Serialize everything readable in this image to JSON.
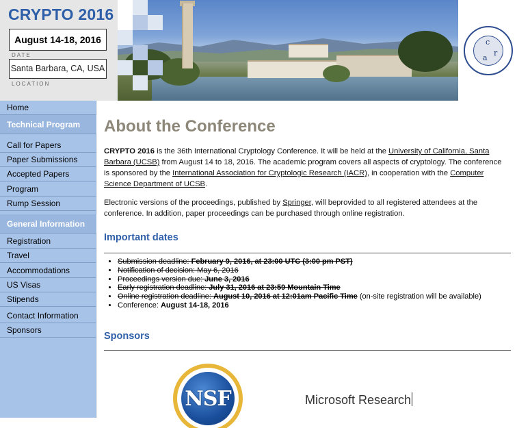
{
  "header": {
    "brand": "CRYPTO 2016",
    "date": "August 14-18, 2016",
    "date_caption": "DATE",
    "location": "Santa Barbara, CA, USA",
    "location_caption": "LOCATION",
    "seal_letters": [
      "c",
      "r",
      "a"
    ]
  },
  "sidebar": {
    "home": "Home",
    "technical_heading": "Technical Program",
    "technical_items": [
      "Call for Papers",
      "Paper Submissions",
      "Accepted Papers",
      "Program",
      "Rump Session"
    ],
    "general_heading": "General Information",
    "general_items": [
      "Registration",
      "Travel",
      "Accommodations",
      "US Visas",
      "Stipends"
    ],
    "extra_items": [
      "Contact Information",
      "Sponsors"
    ]
  },
  "main": {
    "title": "About the Conference",
    "intro": {
      "strong": "CRYPTO 2016",
      "t1": " is the 36th International Cryptology Conference. It will be held at the ",
      "link_ucsb": "University of California, Santa Barbara (UCSB)",
      "t2": " from August 14 to 18, 2016. The academic program covers all aspects of cryptology. The conference is sponsored by the ",
      "link_iacr": "International Association for Cryptologic Research (IACR)",
      "t3": ", in cooperation with the ",
      "link_cs": "Computer Science Department of UCSB",
      "t4": "."
    },
    "proceedings": {
      "t1": "Electronic versions of the proceedings, published by ",
      "link_springer": "Springer",
      "t2": ", will beprovided to all registered attendees at the conference. In addition, paper proceedings can be purchased through online registration."
    },
    "important_dates_heading": "Important dates",
    "dates": [
      {
        "label": "Submission deadline: ",
        "value": "February 9, 2016, at 23:00 UTC (3:00 pm PST)",
        "extra": ""
      },
      {
        "label": "Notification of decision: May 6, 2016",
        "value": "",
        "extra": ""
      },
      {
        "label": "Proceedings version due: ",
        "value": "June 3, 2016",
        "extra": ""
      },
      {
        "label": "Early registration deadline: ",
        "value": "July 31, 2016 at 23:59 Mountain Time",
        "extra": ""
      },
      {
        "label": "Online registration deadline: ",
        "value": "August 10, 2016 at 12:01am Pacific Time",
        "extra": " (on-site registration will be available)"
      },
      {
        "label": "Conference: ",
        "value": "August 14-18, 2016",
        "extra": ""
      }
    ],
    "sponsors_heading": "Sponsors",
    "sponsors": {
      "nsf": "NSF",
      "microsoft": "Microsoft Research"
    }
  },
  "colors": {
    "brand_blue": "#2e5fa8",
    "sidebar_bg": "#a8c3e8",
    "title_gray": "#8d8779"
  }
}
